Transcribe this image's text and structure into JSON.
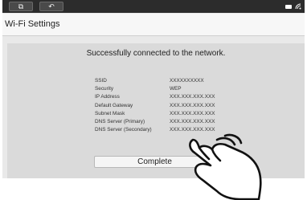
{
  "topbar": {
    "buttons": [
      {
        "icon": "window-switch-icon",
        "glyph": "⧉"
      },
      {
        "icon": "back-icon",
        "glyph": "↶"
      }
    ],
    "status": {
      "battery_icon": "battery-icon",
      "signal_icon": "wifi-signal-icon"
    }
  },
  "window": {
    "title": "Wi-Fi Settings"
  },
  "main": {
    "headline": "Successfully connected to the network.",
    "info": [
      {
        "label": "SSID",
        "value": "XXXXXXXXXX"
      },
      {
        "label": "Security",
        "value": "WEP"
      },
      {
        "label": "IP Address",
        "value": "XXX.XXX.XXX.XXX"
      },
      {
        "label": "Default Gateway",
        "value": "XXX.XXX.XXX.XXX"
      },
      {
        "label": "Subnet Mask",
        "value": "XXX.XXX.XXX.XXX"
      },
      {
        "label": "DNS Server (Primary)",
        "value": "XXX.XXX.XXX.XXX"
      },
      {
        "label": "DNS Server (Secondary)",
        "value": "XXX.XXX.XXX.XXX"
      }
    ],
    "complete_label": "Complete"
  },
  "colors": {
    "topbar": "#2c2c2c",
    "panel": "#dadada",
    "background": "#e9e9e9"
  }
}
